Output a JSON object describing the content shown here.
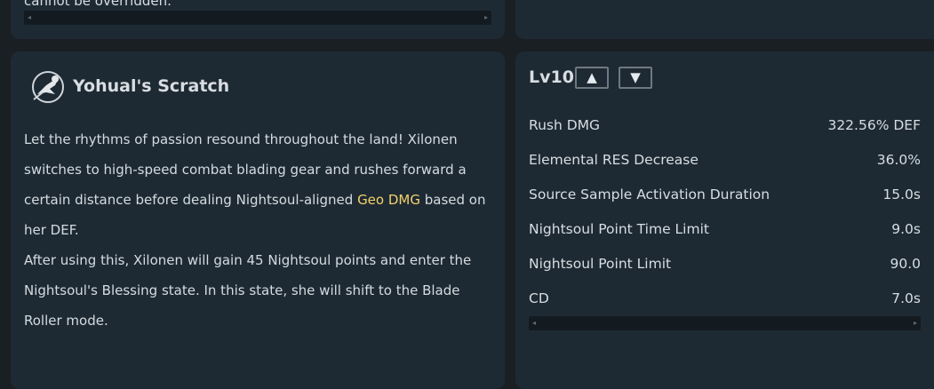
{
  "top_left_card": {
    "cut_text": "cannot be overridden."
  },
  "skill": {
    "title": "Yohual's Scratch",
    "desc_line1_pre": "Let the rhythms of passion resound throughout the land! Xilonen switches to high-speed combat blading gear and rushes forward a certain distance before dealing Nightsoul-aligned ",
    "desc_highlight": "Geo DMG",
    "desc_line1_post": " based on her DEF.",
    "desc_line2": "After using this, Xilonen will gain 45 Nightsoul points and enter the Nightsoul's Blessing state. In this state, she will shift to the Blade Roller mode.",
    "highlight_color": "#f3d16c"
  },
  "stats": {
    "level": "Lv10",
    "up_glyph": "▲",
    "down_glyph": "▼",
    "rows": [
      {
        "label": "Rush DMG",
        "value": "322.56% DEF"
      },
      {
        "label": "Elemental RES Decrease",
        "value": "36.0%"
      },
      {
        "label": "Source Sample Activation Duration",
        "value": "15.0s"
      },
      {
        "label": "Nightsoul Point Time Limit",
        "value": "9.0s"
      },
      {
        "label": "Nightsoul Point Limit",
        "value": "90.0"
      },
      {
        "label": "CD",
        "value": "7.0s"
      }
    ]
  },
  "scroll_arrows": {
    "left": "◂",
    "right": "▸"
  }
}
